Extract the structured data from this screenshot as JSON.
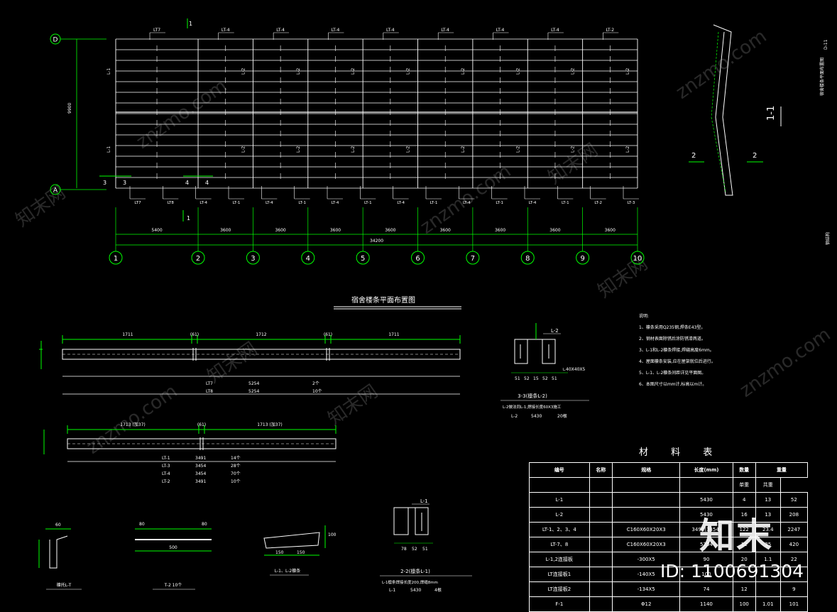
{
  "plan": {
    "title": "宿舍楼条平面布置图",
    "axes_num": [
      "1",
      "2",
      "3",
      "4",
      "5",
      "6",
      "7",
      "8",
      "9",
      "10"
    ],
    "axes_letter": [
      "D",
      "A"
    ],
    "spans": [
      "5400",
      "3600",
      "3600",
      "3600",
      "3600",
      "3600",
      "3600",
      "3600",
      "3600"
    ],
    "total": "34200",
    "depth": "9900",
    "top_labels": [
      "LT7",
      "LT-4",
      "LT-4",
      "LT-4",
      "LT-4",
      "LT-4",
      "LT-4",
      "LT-4",
      "LT-2"
    ],
    "bottom_labels": [
      "LT7",
      "LT8",
      "LT-4",
      "LT-1",
      "LT-4",
      "LT-1",
      "LT-4",
      "LT-1",
      "LT-4",
      "LT-1",
      "LT-4",
      "LT-1",
      "LT-4",
      "LT-1",
      "LT-2",
      "LT-3"
    ],
    "beam_labels": [
      "L-1",
      "L-2"
    ],
    "section_marks": [
      "1",
      "3",
      "4"
    ]
  },
  "elev1": {
    "dims": [
      "1711",
      "(61)",
      "1712",
      "(61)",
      "1711"
    ],
    "rows": [
      [
        "LT7",
        "5254",
        "2个"
      ],
      [
        "LT8",
        "5254",
        "10个"
      ]
    ]
  },
  "elev2": {
    "dims": [
      "1713 (加37)",
      "(61)",
      "1713 (加37)"
    ],
    "rows": [
      [
        "LT-1",
        "3491",
        "14个"
      ],
      [
        "LT-3",
        "3454",
        "28个"
      ],
      [
        "LT-4",
        "3454",
        "70个"
      ],
      [
        "LT-2",
        "3491",
        "10个"
      ]
    ]
  },
  "sec33": {
    "caption": "3-3(檩条L-2)",
    "note": "L-2做法同L-1,焊接长度60X3施工",
    "row": [
      "L-2",
      "5430",
      "20根"
    ],
    "dims": [
      "51",
      "52",
      "15",
      "52",
      "51"
    ],
    "label": "L-2",
    "angle": "∟40X40X5"
  },
  "sec22": {
    "caption": "2-2(檩条L-1)",
    "note": "L-1檩条焊接长度200,焊缝8mm",
    "row": [
      "L-1",
      "5430",
      "4根"
    ],
    "dims": [
      "78",
      "52",
      "51"
    ],
    "label": "L-1"
  },
  "details": {
    "d1": "檩托L-T",
    "d2": "T-2 10个",
    "d3": "L-1、L-2檩条",
    "labels": [
      "60",
      "80",
      "500",
      "150",
      "150",
      "100"
    ]
  },
  "notes": {
    "title": "说明:",
    "items": [
      "1、檩条采用Q235钢,焊条E43型。",
      "2、钢材表面除锈后涂防锈漆两道。",
      "3、L-1和L-2檩条焊接,焊缝高度6mm。",
      "4、屋面檩条安装,应在屋架就位后进行。",
      "5、L-1、L-2檩条间距详见平面图。",
      "6、本图尺寸以mm计,标高以m计。"
    ]
  },
  "materials": {
    "title": "材 料 表",
    "head": [
      "编号",
      "名称",
      "规格",
      "长度(mm)",
      "数量",
      "重量"
    ],
    "sub": [
      "单重",
      "共重"
    ],
    "rows": [
      [
        "L-1",
        "",
        "5430",
        "4",
        "13",
        "52"
      ],
      [
        "L-2",
        "",
        "5430",
        "16",
        "13",
        "208"
      ],
      [
        "LT-1、2、3、4",
        "C160X60X20X3",
        "3491(3454)",
        "122",
        "23.4",
        "2247"
      ],
      [
        "LT-7、8",
        "C160X60X20X3",
        "5254",
        "12",
        "35",
        "420"
      ],
      [
        "L-1,2连接板",
        "-300X5",
        "90",
        "20",
        "1.1",
        "22"
      ],
      [
        "LT连接板1",
        "-140X5",
        "100",
        "",
        "",
        ""
      ],
      [
        "LT连接板2",
        "-134X5",
        "74",
        "12",
        "",
        "9"
      ],
      [
        "F-1",
        "Φ12",
        "1140",
        "100",
        "1.01",
        "101"
      ]
    ]
  },
  "watermark": {
    "brand": "知末",
    "site": "znzmo.com",
    "site_cn": "知末网",
    "id": "ID: 1100691304"
  },
  "side": {
    "title": "1-1",
    "marks": [
      "2",
      "2"
    ],
    "vert": "宿舍楼条平面布置图",
    "code": "D-11",
    "caption": "钢结构"
  }
}
